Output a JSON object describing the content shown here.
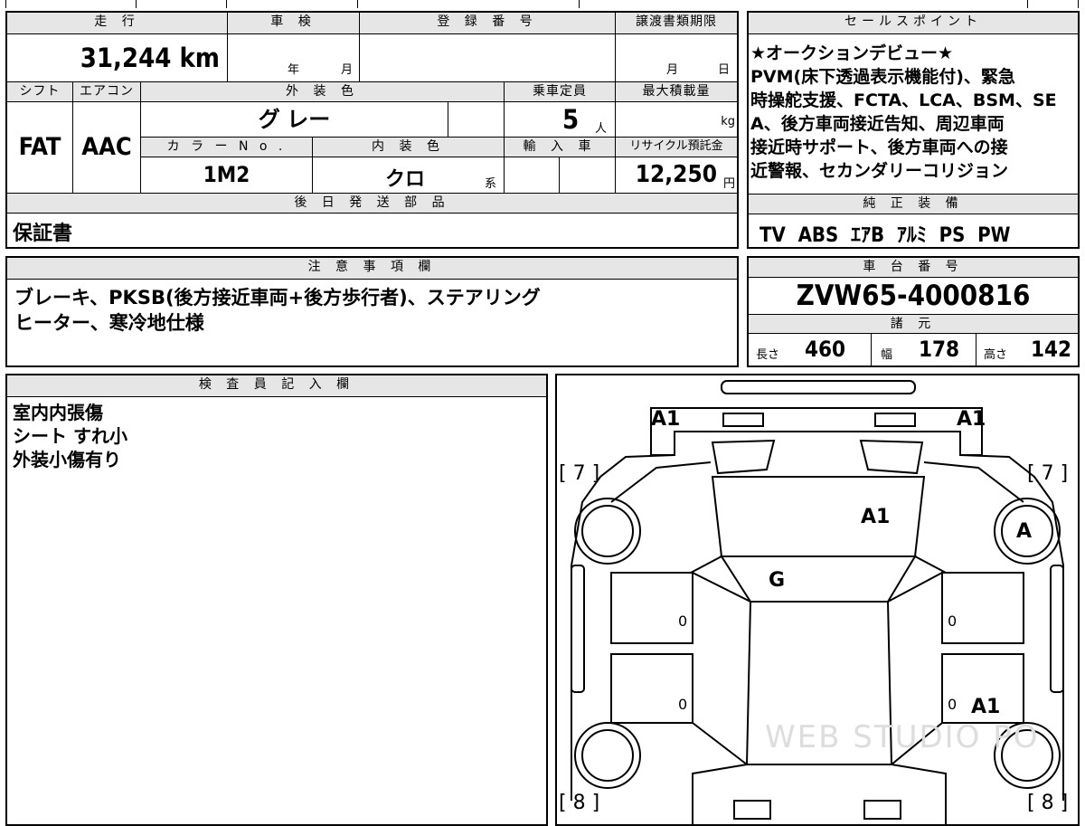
{
  "top_row": {
    "col1": "",
    "col2": "",
    "col3": "",
    "col4": ""
  },
  "mileage": {
    "label": "走 行",
    "value": "31,244 km"
  },
  "inspection": {
    "label": "車 検",
    "year_unit": "年",
    "month_unit": "月"
  },
  "registration": {
    "label": "登 録 番 号",
    "value": ""
  },
  "transfer": {
    "label": "譲渡書類期限",
    "month_unit": "月",
    "day_unit": "日"
  },
  "shift": {
    "label": "シフト",
    "value": "FAT"
  },
  "aircon": {
    "label": "エアコン",
    "value": "AAC"
  },
  "exterior_color": {
    "label": "外 装 色",
    "value": "グ レー"
  },
  "capacity": {
    "label": "乗車定員",
    "value": "5",
    "unit": "人"
  },
  "max_load": {
    "label": "最大積載量",
    "unit": "kg"
  },
  "color_no": {
    "label": "カ ラ ー N o .",
    "value": "1M2"
  },
  "interior_color": {
    "label": "内 装 色",
    "value": "クロ",
    "unit": "系"
  },
  "import": {
    "label": "輸 入 車"
  },
  "recycle": {
    "label": "リサイクル預託金",
    "value": "12,250",
    "unit": "円"
  },
  "later_parts": {
    "label": "後 日 発 送 部 品",
    "value": "保証書"
  },
  "sales_point": {
    "label": "セールスポイント",
    "lines": [
      "★オークションデビュー★",
      "PVM(床下透過表示機能付)、緊急",
      "時操舵支援、FCTA、LCA、BSM、SE",
      "A、後方車両接近告知、周辺車両",
      "接近時サポート、後方車両への接",
      "近警報、セカンダリーコリジョン"
    ]
  },
  "genuine_equipment": {
    "label": "純 正 装 備",
    "value": "TV  ABS  ｴｱB  ｱﾙﾐ  PS  PW"
  },
  "notes": {
    "label": "注 意 事 項 欄",
    "lines": [
      "ブレーキ、PKSB(後方接近車両+後方歩行者)、ステアリング",
      "ヒーター、寒冷地仕様"
    ]
  },
  "chassis": {
    "label": "車 台 番 号",
    "value": "ZVW65-4000816"
  },
  "specs": {
    "label": "諸 元",
    "length_label": "長さ",
    "length": "460",
    "width_label": "幅",
    "width": "178",
    "height_label": "高さ",
    "height": "142"
  },
  "inspector": {
    "label": "検 査 員 記 入 欄",
    "lines": [
      "室内内張傷",
      "シート すれ小",
      "外装小傷有り"
    ]
  },
  "diagram": {
    "marks": {
      "front_left": "A1",
      "front_right": "A1",
      "bracket_tl": "[ 7 ]",
      "bracket_tr": "[ 7 ]",
      "bracket_bl": "[ 8 ]",
      "bracket_br": "[ 8 ]",
      "hood": "A1",
      "windshield": "G",
      "wheel_fr": "A",
      "door_fl": "0",
      "door_rl": "0",
      "door_fr": "0",
      "door_rr": "0",
      "rear_right_door": "A1"
    },
    "watermark": "WEB STUDIO PO"
  }
}
